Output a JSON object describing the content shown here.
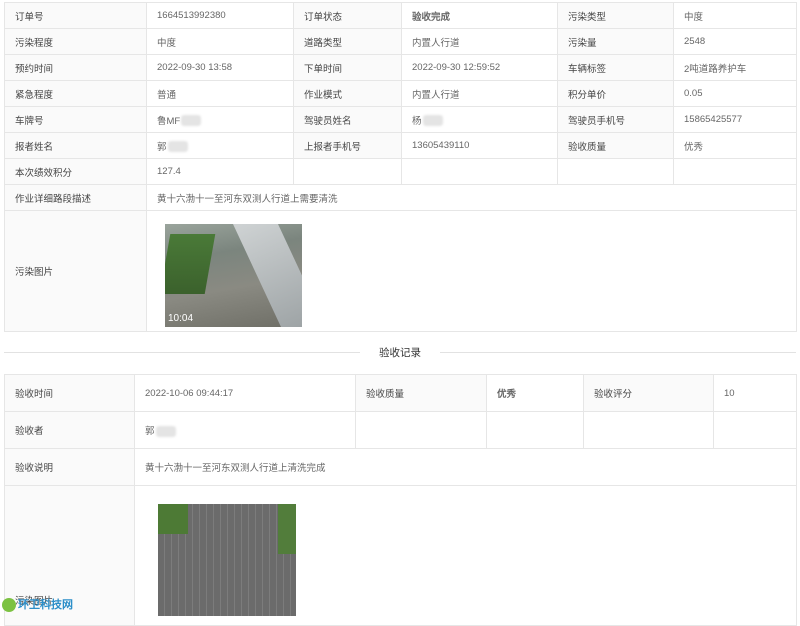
{
  "order": {
    "rows": [
      [
        {
          "l": "订单号",
          "v": "1664513992380"
        },
        {
          "l": "订单状态",
          "v": "验收完成",
          "green": true
        },
        {
          "l": "污染类型",
          "v": "中度"
        }
      ],
      [
        {
          "l": "污染程度",
          "v": "中度"
        },
        {
          "l": "道路类型",
          "v": "内置人行道"
        },
        {
          "l": "污染量",
          "v": "2548"
        }
      ],
      [
        {
          "l": "预约时间",
          "v": "2022-09-30 13:58"
        },
        {
          "l": "下单时间",
          "v": "2022-09-30 12:59:52"
        },
        {
          "l": "车辆标签",
          "v": "2吨道路养护车"
        }
      ],
      [
        {
          "l": "紧急程度",
          "v": "普通"
        },
        {
          "l": "作业模式",
          "v": "内置人行道"
        },
        {
          "l": "积分单价",
          "v": "0.05"
        }
      ],
      [
        {
          "l": "车牌号",
          "v": "鲁MF"
        },
        {
          "l": "驾驶员姓名",
          "v": "杨"
        },
        {
          "l": "驾驶员手机号",
          "v": "15865425577"
        }
      ],
      [
        {
          "l": "报者姓名",
          "v": "郭"
        },
        {
          "l": "上报者手机号",
          "v": "13605439110"
        },
        {
          "l": "验收质量",
          "v": "优秀"
        }
      ]
    ],
    "score_label": "本次绩效积分",
    "score_value": "127.4",
    "desc_label": "作业详细路段描述",
    "desc_value": "黄十六渤十一至河东双测人行道上需要清洗",
    "image_label": "污染图片",
    "image_timestamp": "10:04"
  },
  "section_title": "验收记录",
  "acceptance": {
    "time_label": "验收时间",
    "time_value": "2022-10-06 09:44:17",
    "quality_label": "验收质量",
    "quality_value": "优秀",
    "rating_label": "验收评分",
    "rating_value": "10",
    "inspector_label": "验收者",
    "inspector_value": "郭",
    "note_label": "验收说明",
    "note_value": "黄十六渤十一至河东双测人行道上清洗完成",
    "image_label": "污染图片"
  },
  "watermark": "环卫科技网",
  "colors": {
    "accent_green": "#2fa31a",
    "label_bg": "#fafafa",
    "border": "#e6e6e6",
    "watermark": "#2c8fc9"
  }
}
